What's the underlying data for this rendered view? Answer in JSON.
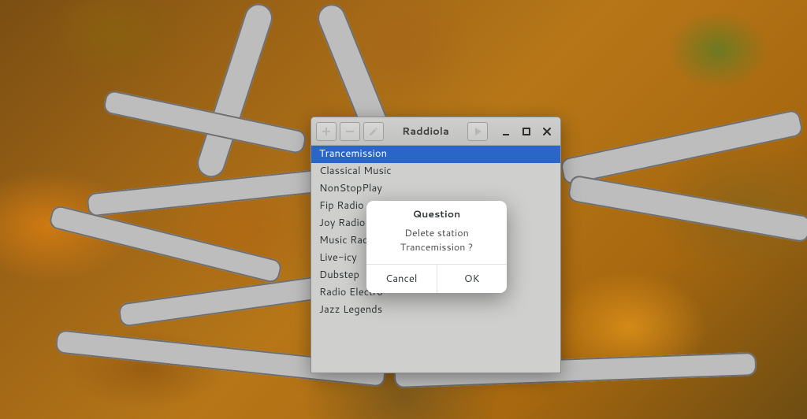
{
  "window": {
    "title": "Raddiola",
    "toolbar": {
      "add_icon": "plus-icon",
      "remove_icon": "minus-icon",
      "edit_icon": "pencil-icon",
      "play_icon": "play-icon"
    },
    "controls": {
      "minimize_icon": "minimize-icon",
      "maximize_icon": "maximize-icon",
      "close_icon": "close-icon"
    }
  },
  "stations": [
    {
      "name": "Trancemission",
      "selected": true
    },
    {
      "name": "Classical Music",
      "selected": false
    },
    {
      "name": "NonStopPlay",
      "selected": false
    },
    {
      "name": "Fip Radio",
      "selected": false
    },
    {
      "name": "Joy Radio",
      "selected": false
    },
    {
      "name": "Music Radio",
      "selected": false
    },
    {
      "name": "Live-icy",
      "selected": false
    },
    {
      "name": "Dubstep",
      "selected": false
    },
    {
      "name": "Radio Electro",
      "selected": false
    },
    {
      "name": "Jazz Legends",
      "selected": false
    }
  ],
  "dialog": {
    "title": "Question",
    "message": "Delete station Trancemission ?",
    "cancel_label": "Cancel",
    "ok_label": "OK"
  }
}
